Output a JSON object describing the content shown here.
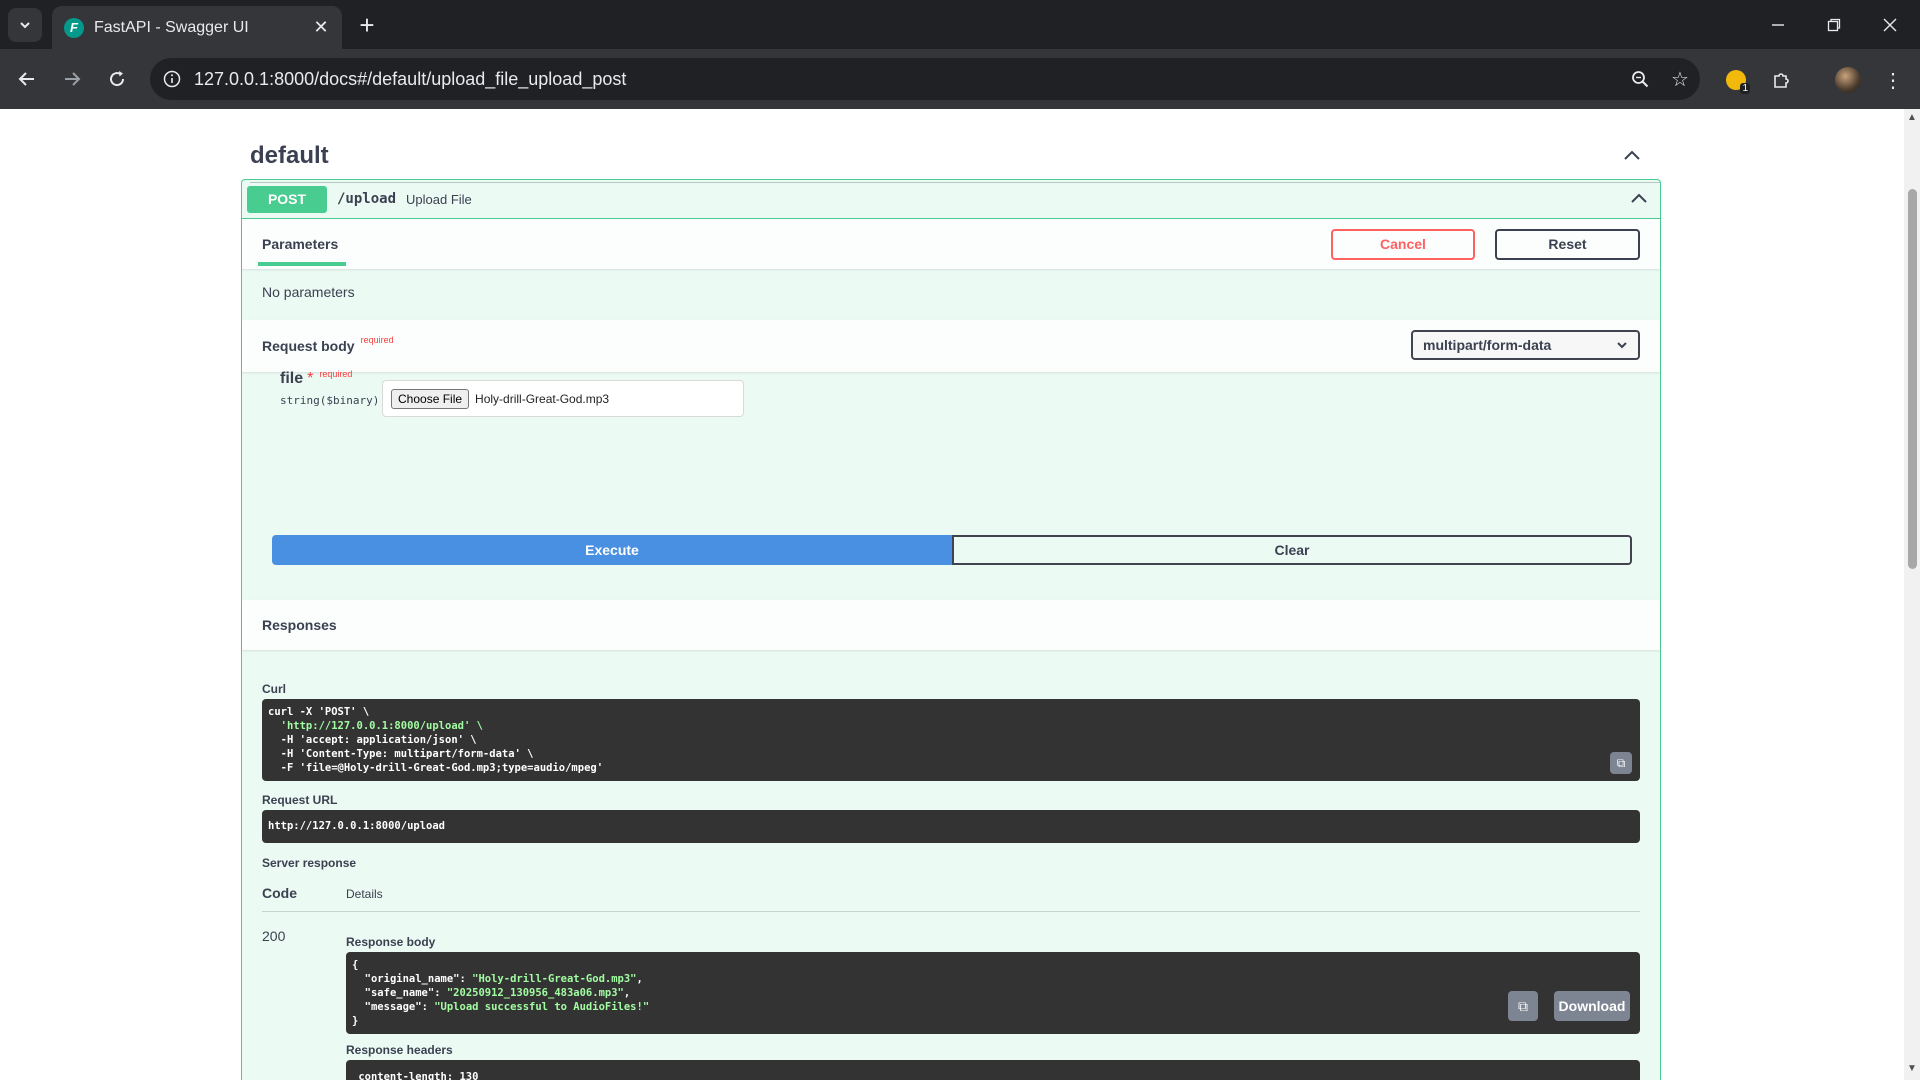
{
  "browser": {
    "tab_title": "FastAPI - Swagger UI",
    "favicon_letter": "F",
    "url": "127.0.0.1:8000/docs#/default/upload_file_upload_post",
    "extension_badge": "1"
  },
  "tag": {
    "title": "default"
  },
  "operation": {
    "method": "POST",
    "path": "/upload",
    "summary": "Upload File",
    "params_tab": "Parameters",
    "cancel_label": "Cancel",
    "reset_label": "Reset",
    "no_params": "No parameters",
    "request_body_title": "Request body",
    "required_label": "required",
    "content_type": "multipart/form-data",
    "file_param": {
      "name": "file",
      "star": "*",
      "required": "required",
      "type": "string($binary)",
      "choose_label": "Choose File",
      "file_name": "Holy-drill-Great-God.mp3"
    },
    "execute_label": "Execute",
    "clear_label": "Clear"
  },
  "responses": {
    "title": "Responses",
    "curl_label": "Curl",
    "curl_lines": [
      "curl -X 'POST' \\",
      "  'http://127.0.0.1:8000/upload' \\",
      "  -H 'accept: application/json' \\",
      "  -H 'Content-Type: multipart/form-data' \\",
      "  -F 'file=@Holy-drill-Great-God.mp3;type=audio/mpeg'"
    ],
    "request_url_label": "Request URL",
    "request_url": "http://127.0.0.1:8000/upload",
    "server_response_label": "Server response",
    "code_header": "Code",
    "details_header": "Details",
    "status_code": "200",
    "response_body_label": "Response body",
    "response_body": {
      "open": "{",
      "k1": "\"original_name\"",
      "v1": "\"Holy-drill-Great-God.mp3\"",
      "k2": "\"safe_name\"",
      "v2": "\"20250912_130956_483a06.mp3\"",
      "k3": "\"message\"",
      "v3": "\"Upload successful to AudioFiles!\"",
      "close": "}"
    },
    "download_label": "Download",
    "response_headers_label": "Response headers",
    "headers_first_line": " content-length: 130 "
  },
  "colors": {
    "post_green": "#49cc90",
    "execute_blue": "#4990e2",
    "cancel_red": "#ff6060",
    "code_bg": "#333333",
    "string_green": "#a2fca2"
  }
}
